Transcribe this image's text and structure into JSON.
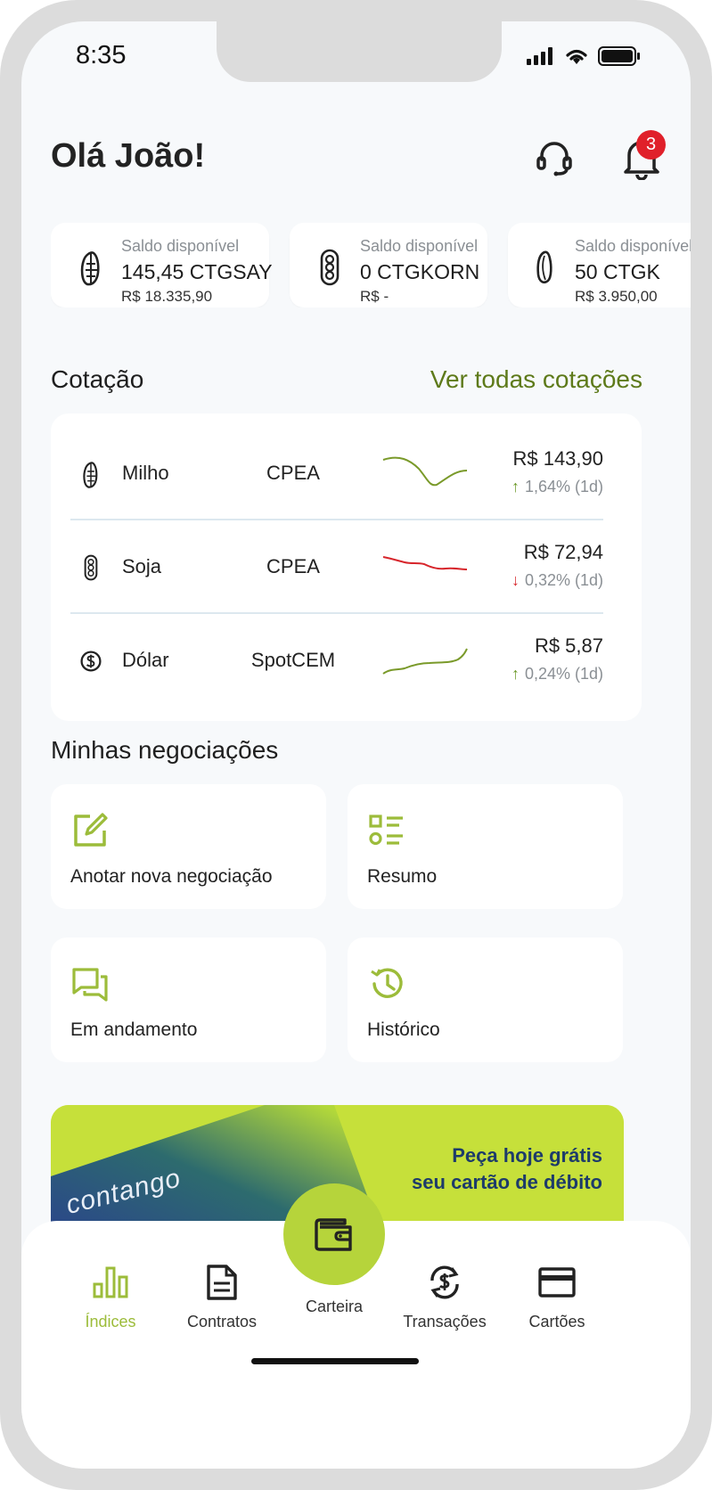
{
  "status_bar": {
    "time": "8:35"
  },
  "header": {
    "greeting": "Olá João!",
    "notifications_count": "3"
  },
  "balances": [
    {
      "label": "Saldo disponível",
      "amount": "145,45 CTGSAY",
      "fiat": "R$ 18.335,90",
      "icon": "corn-icon"
    },
    {
      "label": "Saldo disponível",
      "amount": "0 CTGKORN",
      "fiat": "R$ -",
      "icon": "soy-icon"
    },
    {
      "label": "Saldo disponível",
      "amount": "50 CTGK",
      "fiat": "R$ 3.950,00",
      "icon": "bean-icon"
    }
  ],
  "quotes_section": {
    "title": "Cotação",
    "see_all": "Ver todas cotações",
    "rows": [
      {
        "name": "Milho",
        "market": "CPEA",
        "price": "R$ 143,90",
        "change": "1,64% (1d)",
        "direction": "up",
        "icon": "corn-icon",
        "spark_color": "#7a9a2a"
      },
      {
        "name": "Soja",
        "market": "CPEA",
        "price": "R$ 72,94",
        "change": "0,32% (1d)",
        "direction": "down",
        "icon": "soy-icon",
        "spark_color": "#d7262c"
      },
      {
        "name": "Dólar",
        "market": "SpotCEM",
        "price": "R$ 5,87",
        "change": "0,24% (1d)",
        "direction": "up",
        "icon": "dollar-icon",
        "spark_color": "#7a9a2a"
      }
    ]
  },
  "negotiations": {
    "title": "Minhas negociações",
    "tiles": [
      {
        "label": "Anotar nova negociação",
        "icon": "edit-icon"
      },
      {
        "label": "Resumo",
        "icon": "list-icon"
      },
      {
        "label": "Em andamento",
        "icon": "chat-icon"
      },
      {
        "label": "Histórico",
        "icon": "history-icon"
      }
    ]
  },
  "promo": {
    "brand": "contango",
    "line1": "Peça hoje grátis",
    "line2": "seu cartão de débito"
  },
  "bottom_nav": {
    "items": [
      {
        "label": "Índices",
        "icon": "chart-bars-icon",
        "active": true
      },
      {
        "label": "Contratos",
        "icon": "document-icon"
      },
      {
        "label": "Carteira",
        "icon": "wallet-icon"
      },
      {
        "label": "Transações",
        "icon": "exchange-icon"
      },
      {
        "label": "Cartões",
        "icon": "card-icon"
      }
    ]
  },
  "colors": {
    "accent": "#9cbc3a",
    "accent_dark": "#5e7a1a",
    "badge": "#e0202a",
    "background": "#f7f9fb"
  }
}
